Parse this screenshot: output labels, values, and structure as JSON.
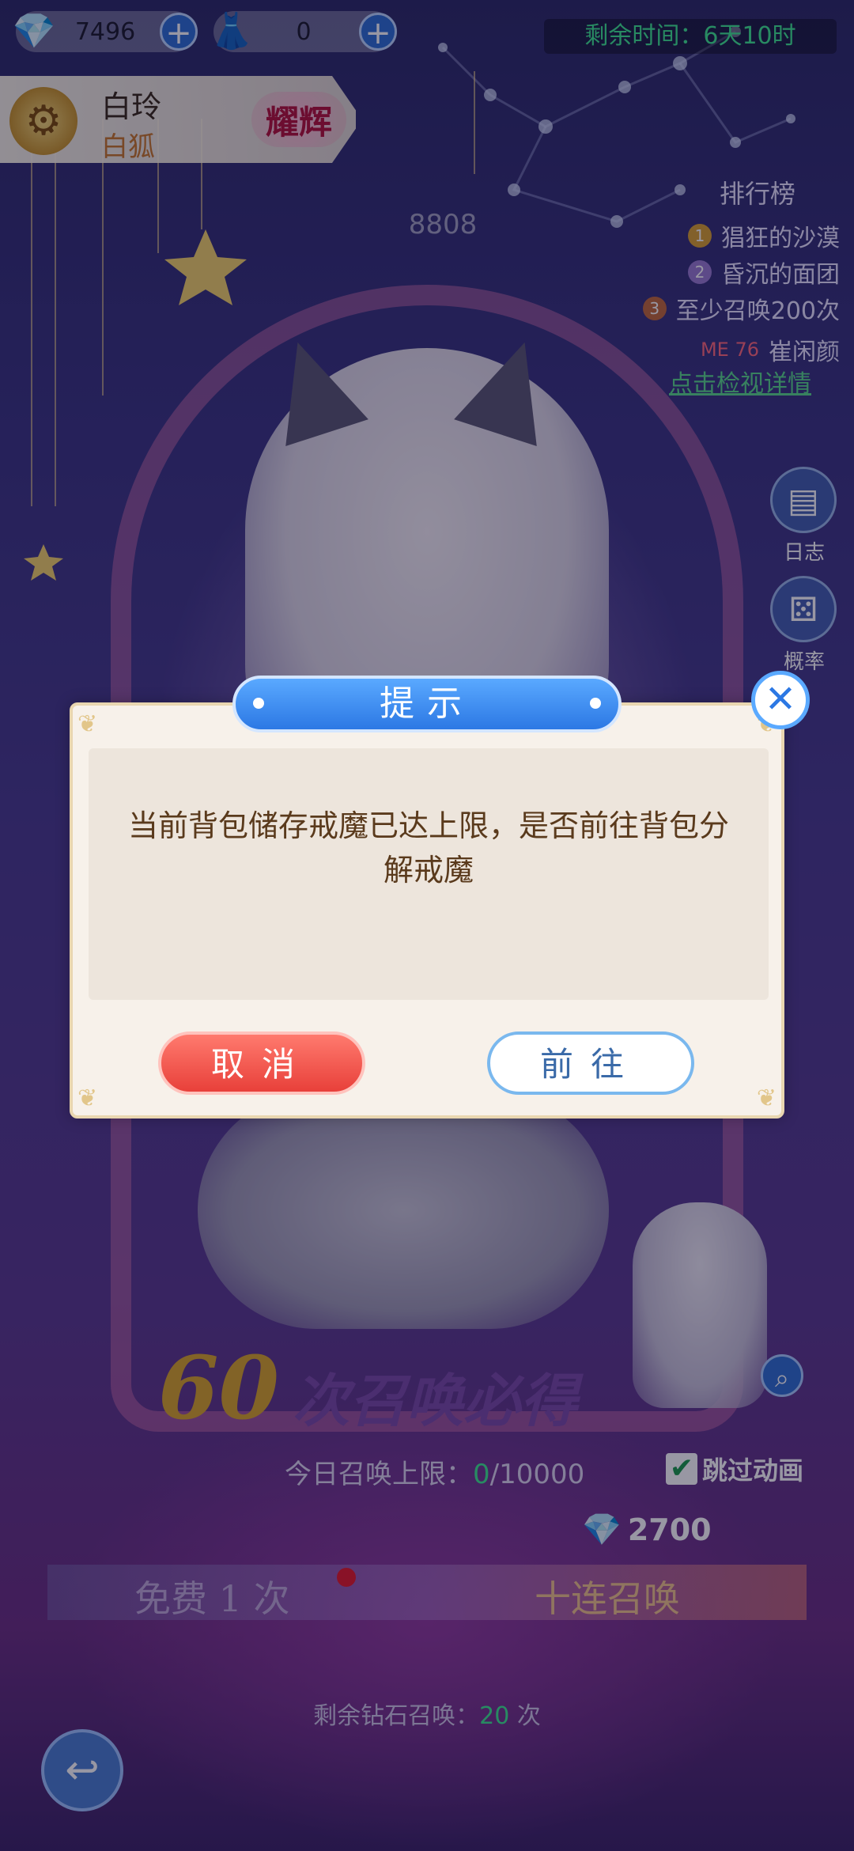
{
  "top_bar": {
    "gems": {
      "value": "7496",
      "icon": "crystal-icon"
    },
    "dress": {
      "value": "0",
      "icon": "wedding-dress-icon"
    },
    "timer_text": "剩余时间：6天10时"
  },
  "character": {
    "name": "白玲",
    "type": "白狐",
    "rank_badge": "耀辉"
  },
  "score": "8808",
  "leaderboard": {
    "title": "排行榜",
    "entries": [
      {
        "rank": "1",
        "name": "猖狂的沙漠"
      },
      {
        "rank": "2",
        "name": "昏沉的面团"
      },
      {
        "rank": "3",
        "name": "至少召唤200次"
      },
      {
        "rank": "ME 76",
        "name": "崔闲颜"
      }
    ],
    "link": "点击检视详情"
  },
  "side_buttons": [
    {
      "label": "日志",
      "icon": "journal-icon"
    },
    {
      "label": "概率",
      "icon": "dice-icon"
    }
  ],
  "summon": {
    "guarantee_number": "60",
    "guarantee_text": "次召唤必得",
    "daily_limit_label": "今日召唤上限：",
    "daily_limit_used": "0",
    "daily_limit_total": "/10000",
    "skip_animation": "跳过动画",
    "skip_checked": true,
    "ten_cost": "2700",
    "free_label": "免费 1 次",
    "ten_label": "十连召唤",
    "remain_label": "剩余钻石召唤：",
    "remain_count": "20",
    "remain_unit": " 次"
  },
  "dialog": {
    "title": "提示",
    "message": "当前背包储存戒魔已达上限，是否前往背包分解戒魔",
    "cancel": "取消",
    "confirm": "前往",
    "close_icon": "close-icon"
  },
  "colors": {
    "accent_blue": "#2c78e4",
    "cancel_red": "#e8403a",
    "highlight_green": "#3fe88f",
    "dialog_text": "#5a3a1c"
  }
}
